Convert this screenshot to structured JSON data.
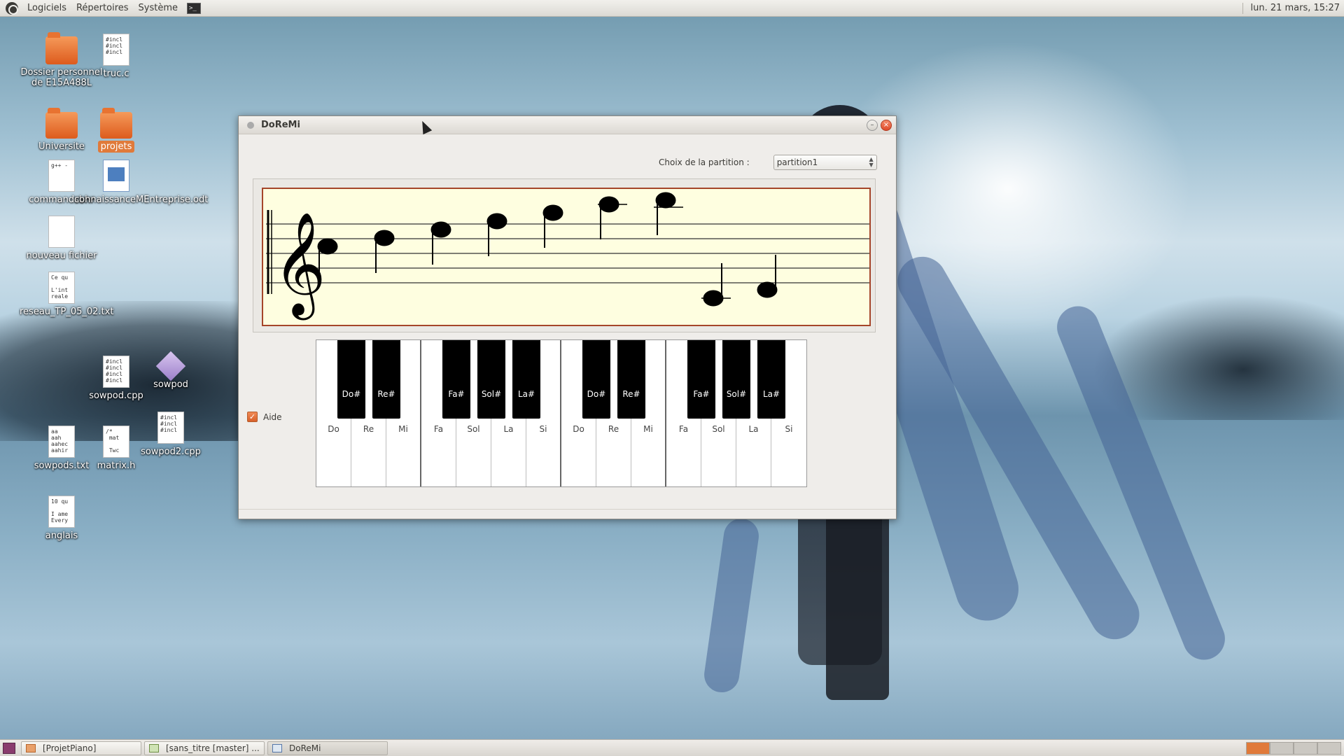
{
  "top_panel": {
    "menus": [
      "Logiciels",
      "Répertoires",
      "Système"
    ],
    "clock": "lun. 21 mars, 15:27"
  },
  "desktop_icons": [
    {
      "label": "Dossier personnel de E15A488L",
      "icon": "home-folder-icon"
    },
    {
      "label": "truc.c",
      "icon": "text-file-icon",
      "preview": "#incl\n#incl\n#incl"
    },
    {
      "label": "Universite",
      "icon": "folder-icon"
    },
    {
      "label": "projets",
      "icon": "folder-icon"
    },
    {
      "label": "commandsbhr",
      "icon": "text-file-icon",
      "preview": "g++ -"
    },
    {
      "label": "connaissanceMEntreprise.odt",
      "icon": "odt-file-icon"
    },
    {
      "label": "nouveau fichier",
      "icon": "text-file-icon",
      "preview": ""
    },
    {
      "label": "reseau_TP_05_02.txt",
      "icon": "text-file-icon",
      "preview": "Ce qu\n\nL'int\nreale"
    },
    {
      "label": "sowpod.cpp",
      "icon": "text-file-icon",
      "preview": "#incl\n#incl\n#incl\n#incl"
    },
    {
      "label": "sowpod",
      "icon": "executable-icon"
    },
    {
      "label": "sowpods.txt",
      "icon": "text-file-icon",
      "preview": "aa\naah\naahec\naahir"
    },
    {
      "label": "matrix.h",
      "icon": "text-file-icon",
      "preview": "/*\n mat\n\n Twc"
    },
    {
      "label": "sowpod2.cpp",
      "icon": "text-file-icon",
      "preview": "#incl\n#incl\n#incl"
    },
    {
      "label": "anglais",
      "icon": "text-file-icon",
      "preview": "10 qu\n\nI ame\nEvery"
    }
  ],
  "window": {
    "title": "DoReMi",
    "choice_label": "Choix de la partition :",
    "combo_value": "partition1",
    "aide_label": "Aide",
    "aide_checked": true,
    "white_keys": [
      "Do",
      "Re",
      "Mi",
      "Fa",
      "Sol",
      "La",
      "Si",
      "Do",
      "Re",
      "Mi",
      "Fa",
      "Sol",
      "La",
      "Si"
    ],
    "black_keys": [
      "Do#",
      "Re#",
      "Fa#",
      "Sol#",
      "La#",
      "Do#",
      "Re#",
      "Fa#",
      "Sol#",
      "La#"
    ]
  },
  "taskbar": {
    "tasks": [
      "[ProjetPiano]",
      "[sans_titre [master] ...",
      "DoReMi"
    ],
    "active_task": 2
  }
}
